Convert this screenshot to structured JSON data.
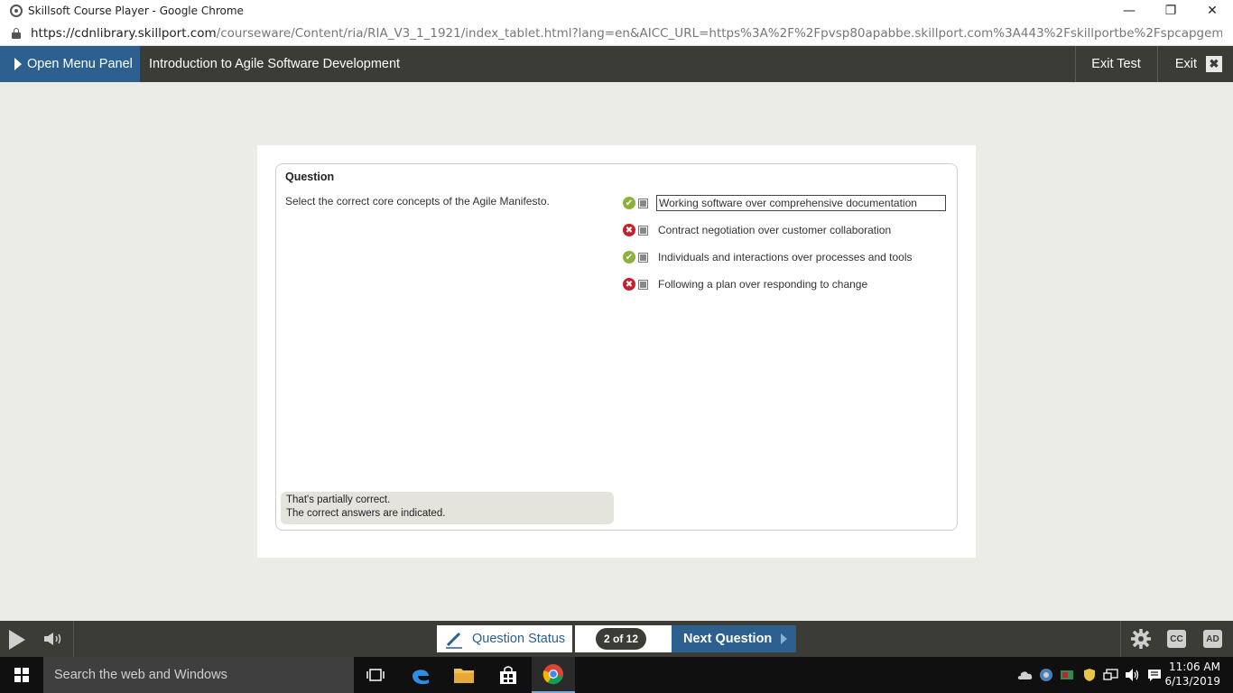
{
  "browser": {
    "window_title": "Skillsoft Course Player - Google Chrome",
    "controls": {
      "minimize": "—",
      "restore": "❐",
      "close": "✕"
    },
    "url_host": "https://cdnlibrary.skillport.com",
    "url_path": "/courseware/Content/ria/RIA_V3_1_1921/index_tablet.html?lang=en&AICC_URL=https%3A%2F%2Fpvsp80apabbe.skillport.com%3A443%2Fskillportbe%2Fspcapgemini%2FResult.rbe..."
  },
  "header": {
    "menu_button": "Open Menu Panel",
    "course_title": "Introduction to Agile Software Development",
    "exit_test": "Exit Test",
    "exit": "Exit",
    "exit_icon": "✖"
  },
  "question": {
    "heading": "Question",
    "text": "Select the correct core concepts of the Agile Manifesto.",
    "options": [
      {
        "label": "Working software over comprehensive documentation",
        "status": "correct",
        "status_glyph": "✔"
      },
      {
        "label": "Contract negotiation over customer collaboration",
        "status": "wrong",
        "status_glyph": "✖"
      },
      {
        "label": "Individuals and interactions over processes and tools",
        "status": "correct",
        "status_glyph": "✔"
      },
      {
        "label": "Following a plan over responding to change",
        "status": "wrong",
        "status_glyph": "✖"
      }
    ],
    "feedback_line1": "That's partially correct.",
    "feedback_line2": "The correct answers are indicated."
  },
  "player": {
    "question_status": "Question Status",
    "counter": "2 of 12",
    "next_question": "Next Question",
    "cc": "CC",
    "ad": "AD"
  },
  "taskbar": {
    "search_placeholder": "Search the web and Windows",
    "time": "11:06 AM",
    "date": "6/13/2019"
  },
  "colors": {
    "accent_blue": "#2d5f8f",
    "header_dark": "#3c3c37",
    "correct_green": "#8bb33c",
    "wrong_red": "#c8202a"
  }
}
